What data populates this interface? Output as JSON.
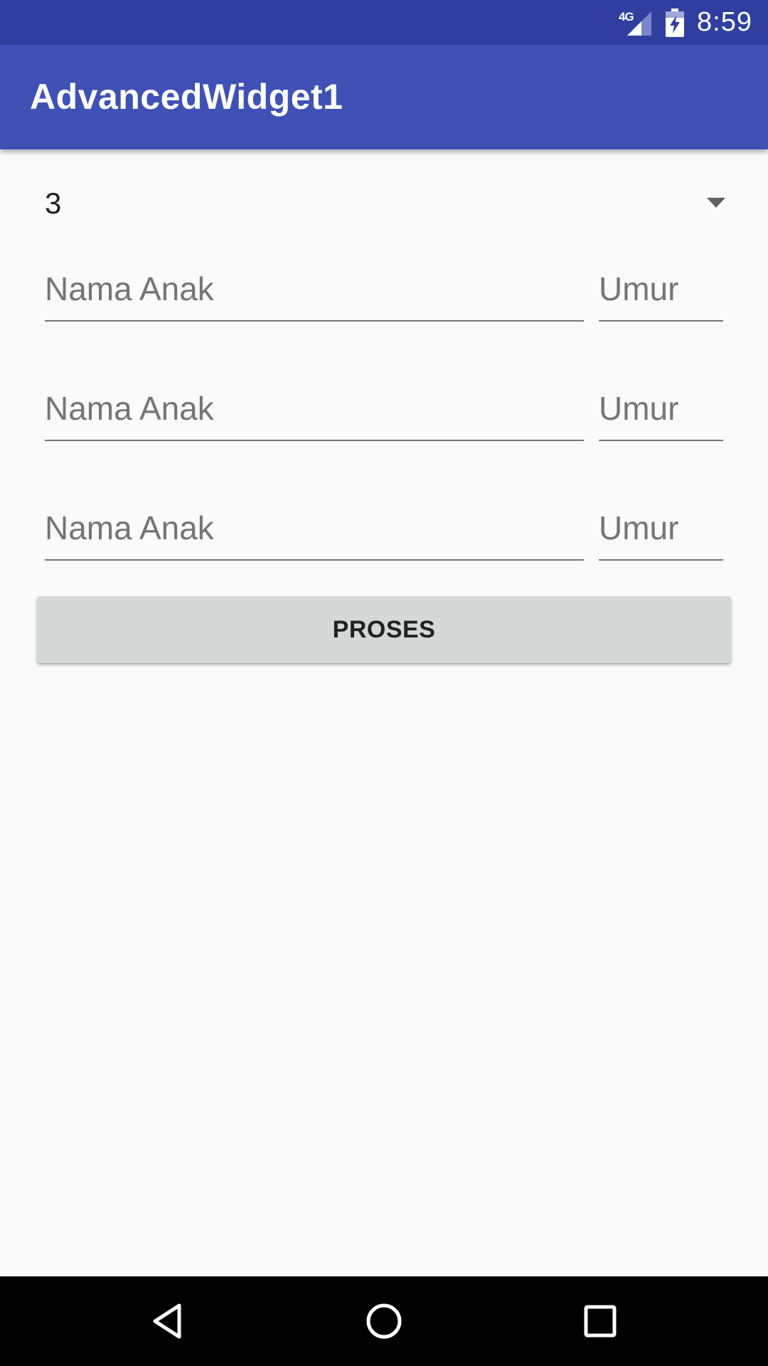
{
  "status_bar": {
    "network": "4G",
    "time": "8:59"
  },
  "app_bar": {
    "title": "AdvancedWidget1"
  },
  "spinner": {
    "selected_value": "3"
  },
  "children": [
    {
      "name_placeholder": "Nama Anak",
      "age_placeholder": "Umur"
    },
    {
      "name_placeholder": "Nama Anak",
      "age_placeholder": "Umur"
    },
    {
      "name_placeholder": "Nama Anak",
      "age_placeholder": "Umur"
    }
  ],
  "button": {
    "label": "PROSES"
  },
  "icons": {
    "signal": "cell-signal-icon",
    "battery": "battery-charging-icon",
    "back": "back-icon",
    "home": "home-icon",
    "recent": "recent-apps-icon"
  },
  "colors": {
    "status_bar": "#303f9f",
    "app_bar": "#3f51b5",
    "background": "#fafafa",
    "button": "#d6d7d7"
  }
}
